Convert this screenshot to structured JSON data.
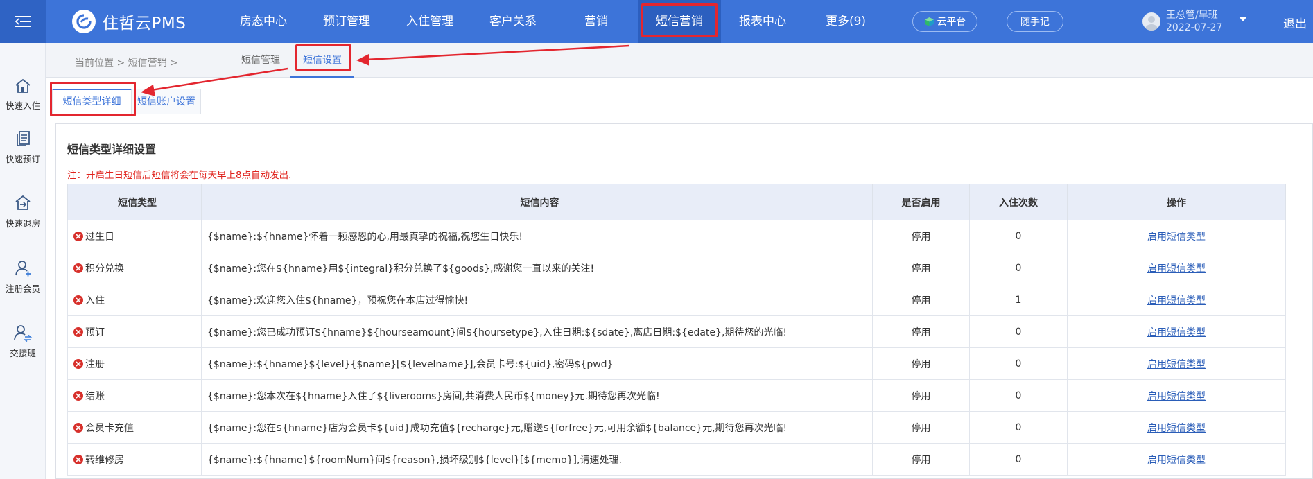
{
  "app": {
    "logo_text": "住哲云PMS"
  },
  "nav": {
    "items": [
      {
        "label": "房态中心"
      },
      {
        "label": "预订管理"
      },
      {
        "label": "入住管理"
      },
      {
        "label": "客户关系"
      },
      {
        "label": "营销"
      },
      {
        "label": "短信营销",
        "active": true
      },
      {
        "label": "报表中心"
      },
      {
        "label": "更多(9)"
      }
    ],
    "cloud_label": "云平台",
    "notes_label": "随手记",
    "user_name": "王总管/早班",
    "user_date": "2022-07-27",
    "logout_label": "退出"
  },
  "sidebar": {
    "items": [
      {
        "label": "快速入住",
        "icon": "home-icon"
      },
      {
        "label": "快速预订",
        "icon": "document-icon"
      },
      {
        "label": "快速退房",
        "icon": "checkout-icon"
      },
      {
        "label": "注册会员",
        "icon": "add-user-icon"
      },
      {
        "label": "交接班",
        "icon": "shift-handover-icon"
      }
    ]
  },
  "breadcrumb": {
    "text": "当前位置 > 短信营销 >"
  },
  "subtabs": {
    "mgmt": "短信管理",
    "settings": "短信设置"
  },
  "tabs": {
    "detail": "短信类型详细",
    "account": "短信账户设置"
  },
  "panel": {
    "title": "短信类型详细设置",
    "note": "注：开启生日短信后短信将会在每天早上8点自动发出."
  },
  "table": {
    "headers": [
      "短信类型",
      "短信内容",
      "是否启用",
      "入住次数",
      "操作"
    ],
    "rows": [
      {
        "type": "过生日",
        "content": "{$name}:${hname}怀着一颗感恩的心,用最真挚的祝福,祝您生日快乐!",
        "enabled": "停用",
        "count": "0",
        "action": "启用短信类型"
      },
      {
        "type": "积分兑换",
        "content": "{$name}:您在${hname}用${integral}积分兑换了${goods},感谢您一直以来的关注!",
        "enabled": "停用",
        "count": "0",
        "action": "启用短信类型"
      },
      {
        "type": "入住",
        "content": "{$name}:欢迎您入住${hname}，预祝您在本店过得愉快!",
        "enabled": "停用",
        "count": "1",
        "action": "启用短信类型"
      },
      {
        "type": "预订",
        "content": "{$name}:您已成功预订${hname}${hourseamount}间${hoursetype},入住日期:${sdate},离店日期:${edate},期待您的光临!",
        "enabled": "停用",
        "count": "0",
        "action": "启用短信类型"
      },
      {
        "type": "注册",
        "content": "{$name}:${hname}${level}{$name}[${levelname}],会员卡号:${uid},密码${pwd}",
        "enabled": "停用",
        "count": "0",
        "action": "启用短信类型"
      },
      {
        "type": "结账",
        "content": "{$name}:您本次在${hname}入住了${liverooms}房间,共消费人民币${money}元.期待您再次光临!",
        "enabled": "停用",
        "count": "0",
        "action": "启用短信类型"
      },
      {
        "type": "会员卡充值",
        "content": "{$name}:您在${hname}店为会员卡${uid}成功充值${recharge}元,赠送${forfree}元,可用余额${balance}元,期待您再次光临!",
        "enabled": "停用",
        "count": "0",
        "action": "启用短信类型"
      },
      {
        "type": "转维修房",
        "content": "{$name}:${hname}${roomNum}间${reason},损坏级别${level}[${memo}],请速处理.",
        "enabled": "停用",
        "count": "0",
        "action": "启用短信类型"
      }
    ]
  },
  "colors": {
    "header_blue": "#3d74d9",
    "highlight_red": "#e3262f",
    "note_red": "#e0231d",
    "link_blue": "#2a5db8"
  }
}
